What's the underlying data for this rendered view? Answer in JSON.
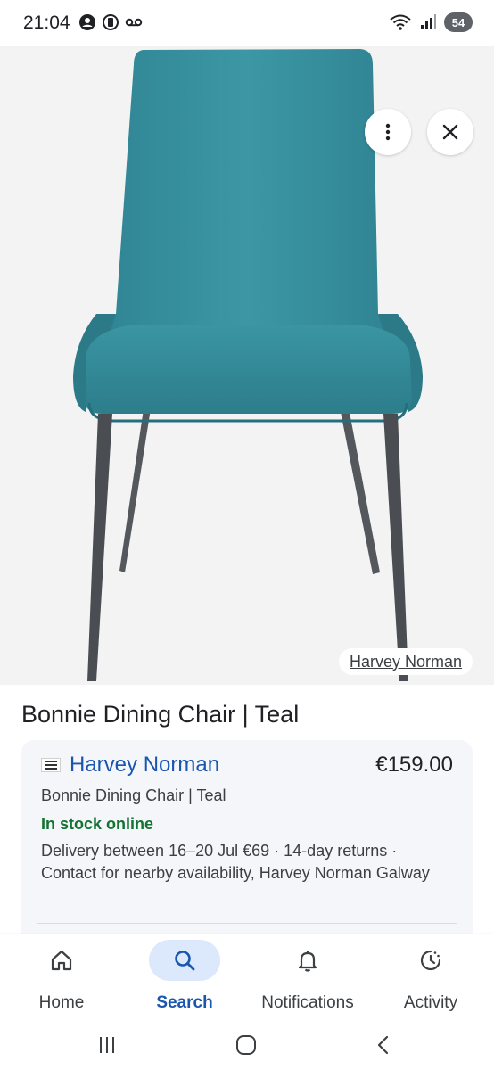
{
  "status_bar": {
    "time": "21:04",
    "left_icons": [
      "account-circle-icon",
      "nfc-icon",
      "voicemail-icon"
    ],
    "right_icons": [
      "wifi-icon",
      "signal-icon"
    ],
    "battery": "54"
  },
  "image_viewer": {
    "source_label": "Harvey Norman",
    "icons": [
      "more-vert-icon",
      "close-icon"
    ]
  },
  "product": {
    "title": "Bonnie Dining Chair | Teal"
  },
  "offer": {
    "merchant": "Harvey Norman",
    "price": "€159.00",
    "product_name": "Bonnie Dining Chair | Teal",
    "stock_status": "In stock online",
    "delivery": "Delivery between 16–20 Jul €69 · 14-day returns · Contact for nearby availability, Harvey Norman Galway"
  },
  "bottom_nav": {
    "items": [
      {
        "label": "Home",
        "icon": "home-icon",
        "active": false
      },
      {
        "label": "Search",
        "icon": "search-icon",
        "active": true
      },
      {
        "label": "Notifications",
        "icon": "bell-icon",
        "active": false
      },
      {
        "label": "Activity",
        "icon": "activity-icon",
        "active": false
      }
    ]
  },
  "system_nav": {
    "icons": [
      "recents-icon",
      "home-circle-icon",
      "back-icon"
    ]
  },
  "colors": {
    "accent": "#1a56b0",
    "stock_green": "#137333",
    "chair_teal": "#3a8f9b",
    "card_bg": "#f4f6f9"
  }
}
